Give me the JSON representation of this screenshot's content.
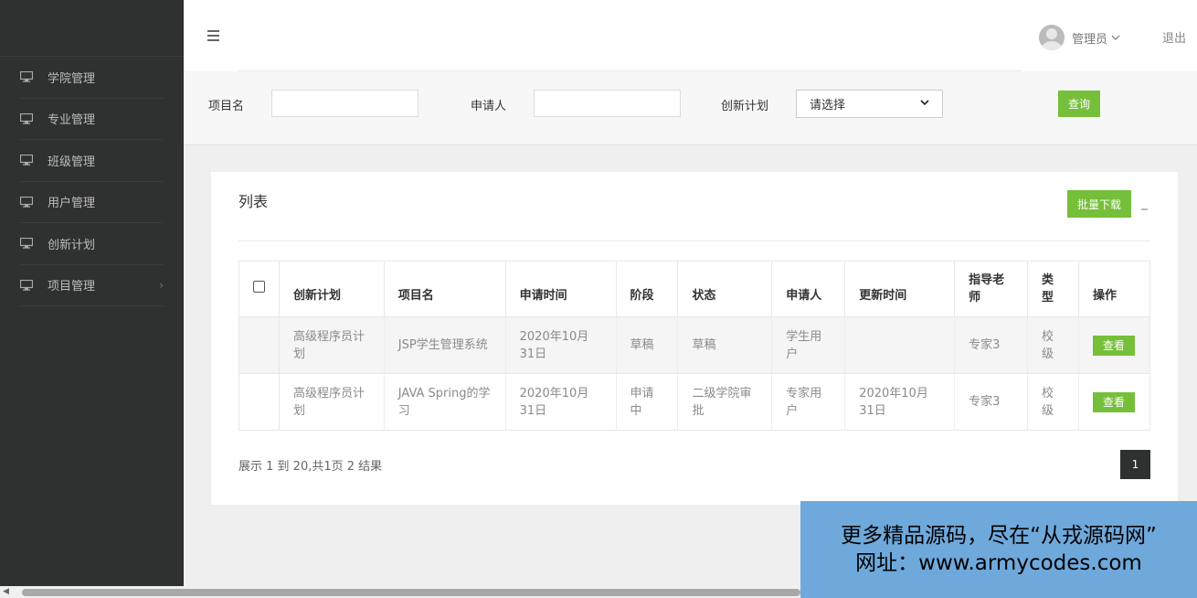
{
  "sidebar": {
    "items": [
      {
        "label": "学院管理"
      },
      {
        "label": "专业管理"
      },
      {
        "label": "班级管理"
      },
      {
        "label": "用户管理"
      },
      {
        "label": "创新计划"
      },
      {
        "label": "项目管理",
        "has_submenu": true
      }
    ]
  },
  "header": {
    "user_name": "管理员",
    "logout_label": "退出"
  },
  "filters": {
    "project_name_label": "项目名",
    "project_name_value": "",
    "applicant_label": "申请人",
    "applicant_value": "",
    "plan_label": "创新计划",
    "plan_selected": "请选择",
    "query_label": "查询"
  },
  "panel": {
    "title": "列表",
    "batch_download_label": "批量下载",
    "collapse_label": "_"
  },
  "table": {
    "headers": [
      "创新计划",
      "项目名",
      "申请时间",
      "阶段",
      "状态",
      "申请人",
      "更新时间",
      "指导老师",
      "类型",
      "操作"
    ],
    "rows": [
      {
        "plan": "高级程序员计划",
        "project": "JSP学生管理系统",
        "apply_time": "2020年10月31日",
        "stage": "草稿",
        "status": "草稿",
        "applicant": "学生用户",
        "update_time": "",
        "teacher": "专家3",
        "type": "校级",
        "action": "查看"
      },
      {
        "plan": "高级程序员计划",
        "project": "JAVA Spring的学习",
        "apply_time": "2020年10月31日",
        "stage": "申请中",
        "status": "二级学院审批",
        "applicant": "专家用户",
        "update_time": "2020年10月31日",
        "teacher": "专家3",
        "type": "校级",
        "action": "查看"
      }
    ]
  },
  "pager": {
    "info": "展示 1 到 20,共1页 2 结果",
    "current_page": "1"
  },
  "watermark": {
    "line1": "更多精品源码，尽在“从戎源码网”",
    "line2": "网址：www.armycodes.com"
  },
  "colors": {
    "sidebar_bg": "#2f3030",
    "accent_green": "#76bf3a",
    "watermark_bg": "#6fa9dc"
  },
  "icons": {
    "sidebar_item": "monitor-icon",
    "menu_toggle": "hamburger-icon",
    "submenu": "chevron-right-icon",
    "user_dropdown": "chevron-down-icon"
  }
}
